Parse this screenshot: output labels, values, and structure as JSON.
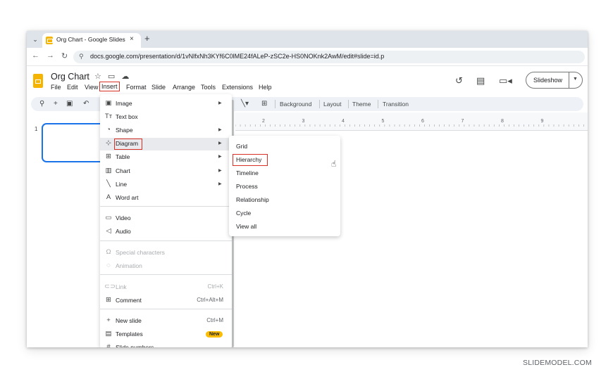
{
  "browser": {
    "tab_title": "Org Chart - Google Slides",
    "tab_close": "×",
    "new_tab": "+",
    "url": "docs.google.com/presentation/d/1vNlfxNh3KYf6C0lME24fALeP-zSC2e-HS0NOKnk2AwM/edit#slide=id.p",
    "nav": {
      "back": "←",
      "forward": "→",
      "reload": "↻",
      "tab_list": "⌄"
    }
  },
  "app": {
    "doc_title": "Org Chart",
    "title_icons": "☆ ▭ ☁",
    "menus": [
      "File",
      "Edit",
      "View",
      "Insert",
      "Format",
      "Slide",
      "Arrange",
      "Tools",
      "Extensions",
      "Help"
    ],
    "slideshow_label": "Slideshow"
  },
  "toolbar": {
    "background": "Background",
    "layout": "Layout",
    "theme": "Theme",
    "transition": "Transition"
  },
  "filmstrip": {
    "slide_number": "1"
  },
  "ruler": {
    "marks": [
      "2",
      "3",
      "4",
      "5",
      "6",
      "7",
      "8",
      "9"
    ]
  },
  "insert_menu": {
    "items": [
      {
        "icon": "image-icon",
        "glyph": "▣",
        "label": "Image",
        "submenu": true
      },
      {
        "icon": "textbox-icon",
        "glyph": "Tт",
        "label": "Text box"
      },
      {
        "icon": "shape-icon",
        "glyph": "◔",
        "label": "Shape",
        "submenu": true
      },
      {
        "icon": "diagram-icon",
        "glyph": "⊹",
        "label": "Diagram",
        "submenu": true
      },
      {
        "icon": "table-icon",
        "glyph": "⊞",
        "label": "Table",
        "submenu": true
      },
      {
        "icon": "chart-icon",
        "glyph": "▥",
        "label": "Chart",
        "submenu": true
      },
      {
        "icon": "line-icon",
        "glyph": "╲",
        "label": "Line",
        "submenu": true
      },
      {
        "icon": "wordart-icon",
        "glyph": "A",
        "label": "Word art"
      },
      {
        "icon": "video-icon",
        "glyph": "▭",
        "label": "Video"
      },
      {
        "icon": "audio-icon",
        "glyph": "◁",
        "label": "Audio"
      },
      {
        "icon": "omega-icon",
        "glyph": "Ω",
        "label": "Special characters",
        "disabled": true
      },
      {
        "icon": "animation-icon",
        "glyph": "◌",
        "label": "Animation",
        "disabled": true
      },
      {
        "icon": "link-icon",
        "glyph": "⊂⊃",
        "label": "Link",
        "shortcut": "Ctrl+K",
        "disabled": true
      },
      {
        "icon": "comment-icon",
        "glyph": "⊞",
        "label": "Comment",
        "shortcut": "Ctrl+Alt+M"
      },
      {
        "icon": "plus-icon",
        "glyph": "+",
        "label": "New slide",
        "shortcut": "Ctrl+M"
      },
      {
        "icon": "templates-icon",
        "glyph": "▤",
        "label": "Templates",
        "badge": "New"
      },
      {
        "icon": "hash-icon",
        "glyph": "#",
        "label": "Slide numbers"
      }
    ]
  },
  "diagram_submenu": {
    "items": [
      "Grid",
      "Hierarchy",
      "Timeline",
      "Process",
      "Relationship",
      "Cycle",
      "View all"
    ],
    "highlighted": "Hierarchy"
  },
  "watermark": "SLIDEMODEL.COM",
  "colors": {
    "accent": "#1a73e8",
    "highlight_box": "#d93025",
    "slides_yellow": "#f4b400",
    "badge": "#fbbc04"
  }
}
